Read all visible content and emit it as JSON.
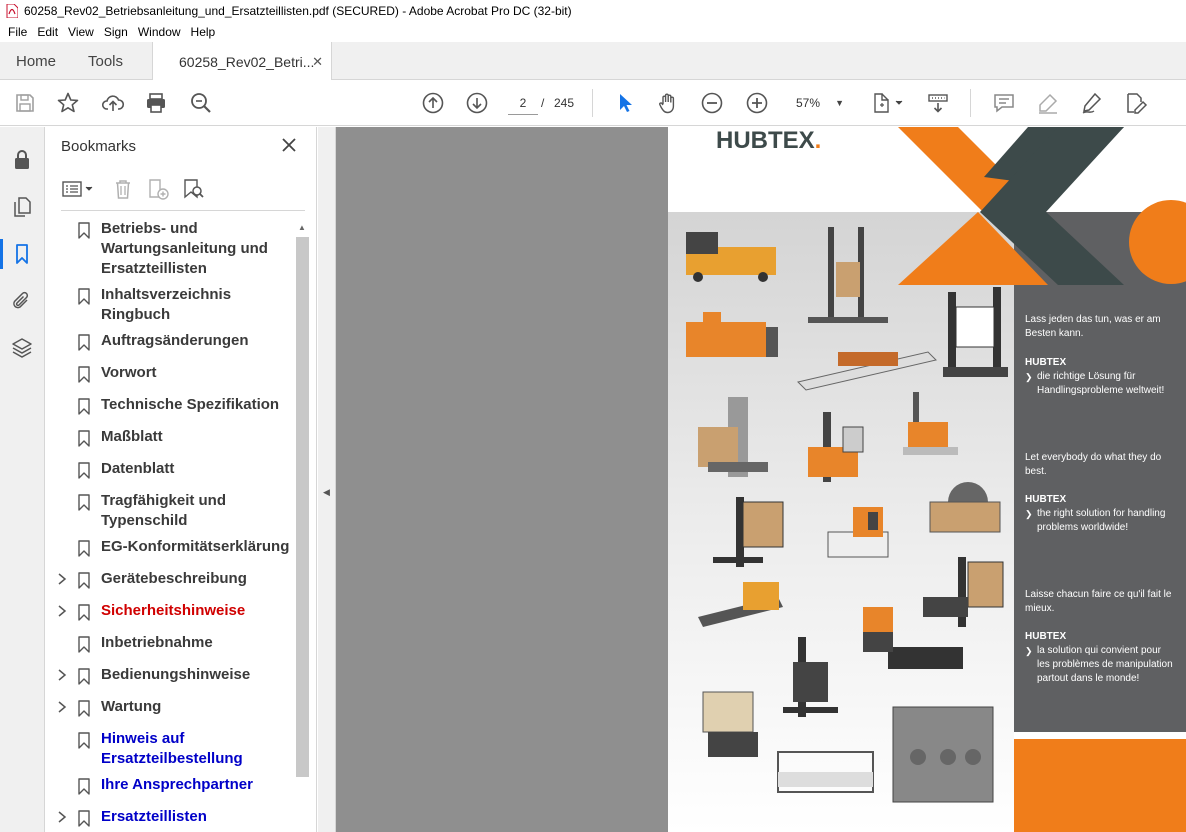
{
  "window": {
    "title": "60258_Rev02_Betriebsanleitung_und_Ersatzteillisten.pdf (SECURED) - Adobe Acrobat Pro DC (32-bit)"
  },
  "menu": [
    "File",
    "Edit",
    "View",
    "Sign",
    "Window",
    "Help"
  ],
  "tabs": {
    "home": "Home",
    "tools": "Tools",
    "document": "60258_Rev02_Betri..."
  },
  "toolbar": {
    "page_current": "2",
    "page_separator": "/",
    "page_total": "245",
    "zoom": "57%"
  },
  "bookmarks": {
    "header": "Bookmarks",
    "items": [
      {
        "label": "Betriebs- und Wartungsanleitung und Ersatzteillisten",
        "expandable": false,
        "color": "default"
      },
      {
        "label": "Inhaltsverzeichnis Ringbuch",
        "expandable": false,
        "color": "default"
      },
      {
        "label": "Auftragsänderungen",
        "expandable": false,
        "color": "default"
      },
      {
        "label": "Vorwort",
        "expandable": false,
        "color": "default"
      },
      {
        "label": "Technische Spezifikation",
        "expandable": false,
        "color": "default"
      },
      {
        "label": "Maßblatt",
        "expandable": false,
        "color": "default"
      },
      {
        "label": "Datenblatt",
        "expandable": false,
        "color": "default"
      },
      {
        "label": "Tragfähigkeit und Typenschild",
        "expandable": false,
        "color": "default"
      },
      {
        "label": "EG-Konformitätserklärung",
        "expandable": false,
        "color": "default"
      },
      {
        "label": "Gerätebeschreibung",
        "expandable": true,
        "color": "default"
      },
      {
        "label": "Sicherheitshinweise",
        "expandable": true,
        "color": "red"
      },
      {
        "label": "Inbetriebnahme",
        "expandable": false,
        "color": "default"
      },
      {
        "label": "Bedienungshinweise",
        "expandable": true,
        "color": "default"
      },
      {
        "label": "Wartung",
        "expandable": true,
        "color": "default"
      },
      {
        "label": "Hinweis auf Ersatzteilbestellung",
        "expandable": false,
        "color": "blue"
      },
      {
        "label": "Ihre Ansprechpartner",
        "expandable": false,
        "color": "blue"
      },
      {
        "label": "Ersatzteillisten",
        "expandable": true,
        "color": "blue"
      }
    ]
  },
  "document_page": {
    "logo": "HUBTEX",
    "logo_dot": ".",
    "blocks": [
      {
        "kind": "text",
        "text": "Lass jeden das tun, was er am Besten kann."
      },
      {
        "kind": "bold",
        "text": "HUBTEX"
      },
      {
        "kind": "bullet",
        "text": "die richtige Lösung für Handlingsprobleme weltweit!"
      },
      {
        "kind": "text",
        "text": "Let everybody do what they do best."
      },
      {
        "kind": "bold",
        "text": "HUBTEX"
      },
      {
        "kind": "bullet",
        "text": "the right solution for handling problems worldwide!"
      },
      {
        "kind": "text",
        "text": "Laisse chacun faire ce qu'il fait le mieux."
      },
      {
        "kind": "bold",
        "text": "HUBTEX"
      },
      {
        "kind": "bullet",
        "text": "la solution qui convient pour les problèmes de manipulation partout dans le monde!"
      }
    ]
  },
  "colors": {
    "accent": "#1473e6",
    "brand_orange": "#f07d1a",
    "brand_grey": "#3d4a4a",
    "bookmark_red": "#d00000",
    "bookmark_blue": "#0000c8"
  }
}
